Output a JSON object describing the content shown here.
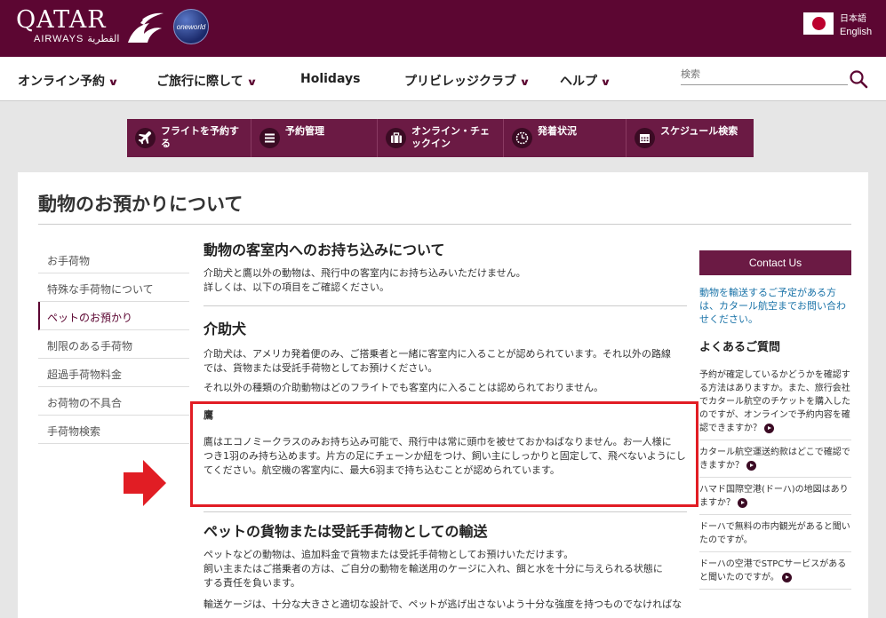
{
  "brand": {
    "name": "QATAR",
    "sub": "AIRWAYS القطرية",
    "alliance": "oneworld"
  },
  "language": {
    "current": "日本語",
    "other": "English"
  },
  "nav": [
    {
      "label": "オンライン予約"
    },
    {
      "label": "ご旅行に際して"
    },
    {
      "label": "Holidays"
    },
    {
      "label": "プリビレッジクラブ"
    },
    {
      "label": "ヘルプ"
    }
  ],
  "search": {
    "placeholder": "検索"
  },
  "tools": [
    {
      "label": "フライトを予約する",
      "icon": "airplane-icon"
    },
    {
      "label": "予約管理",
      "icon": "list-icon"
    },
    {
      "label": "オンライン・チェックイン",
      "icon": "suitcase-icon"
    },
    {
      "label": "発着状況",
      "icon": "clock-icon"
    },
    {
      "label": "スケジュール検索",
      "icon": "calendar-icon"
    }
  ],
  "page_title": "動物のお預かりについて",
  "sidenav": [
    {
      "label": "お手荷物"
    },
    {
      "label": "特殊な手荷物について"
    },
    {
      "label": "ペットのお預かり"
    },
    {
      "label": "制限のある手荷物"
    },
    {
      "label": "超過手荷物料金"
    },
    {
      "label": "お荷物の不具合"
    },
    {
      "label": "手荷物検索"
    }
  ],
  "main": {
    "sec1": {
      "heading": "動物の客室内へのお持ち込みについて",
      "p1": "介助犬と鷹以外の動物は、飛行中の客室内にお持ち込みいただけません。",
      "p2": "詳しくは、以下の項目をご確認ください。"
    },
    "sec2": {
      "heading": "介助犬",
      "p1a": "介助犬は、アメリカ発着便のみ、ご搭乗者と一緒に客室内に入ることが認められています。それ以外の路線",
      "p1b": "では、貨物または受託手荷物としてお預けください。",
      "p2": "それ以外の種類の介助動物はどのフライトでも客室内に入ることは認められておりません。"
    },
    "sec3": {
      "heading": "鷹",
      "l1": "鷹はエコノミークラスのみお持ち込み可能で、飛行中は常に頭巾を被せておかねばなりません。お一人様に",
      "l2": "つき1羽のみ持ち込めます。片方の足にチェーンか紐をつけ、飼い主にしっかりと固定して、飛べないようにし",
      "l3": "てください。航空機の客室内に、最大6羽まで持ち込むことが認められています。"
    },
    "sec4": {
      "heading": "ペットの貨物または受託手荷物としての輸送",
      "l1": "ペットなどの動物は、追加料金で貨物または受託手荷物としてお預けいただけます。",
      "l2": "飼い主またはご搭乗者の方は、ご自分の動物を輸送用のケージに入れ、餌と水を十分に与えられる状態に",
      "l3": "する責任を負います。",
      "l4": "輸送ケージは、十分な大きさと適切な設計で、ペットが逃げ出さないよう十分な強度を持つものでなければな"
    }
  },
  "sidebar": {
    "contact_label": "Contact Us",
    "contact_note": "動物を輸送するご予定がある方は、カタール航空までお問い合わせください。",
    "faq_title": "よくあるご質問",
    "faqs": [
      {
        "text": "予約が確定しているかどうかを確認する方法はありますか。また、旅行会社でカタール航空のチケットを購入したのですが、オンラインで予約内容を確認できますか？"
      },
      {
        "text": "カタール航空運送約款はどこで確認できますか？"
      },
      {
        "text": "ハマド国際空港(ドーハ)の地図はありますか？"
      },
      {
        "text": "ドーハで無料の市内観光があると聞いたのですが。"
      },
      {
        "text": "ドーハの空港でSTPCサービスがあると聞いたのですが。"
      }
    ]
  },
  "colors": {
    "brand": "#5c0632",
    "toolbar": "#6b1a44",
    "highlight": "#e11d24",
    "link": "#1a73a8"
  }
}
